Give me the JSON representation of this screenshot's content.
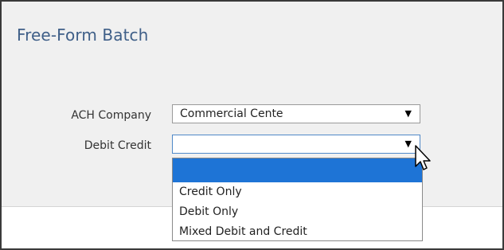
{
  "page": {
    "title": "Free-Form Batch"
  },
  "form": {
    "ach_company": {
      "label": "ACH Company",
      "value": "Commercial Cente"
    },
    "debit_credit": {
      "label": "Debit Credit",
      "value": "",
      "options": [
        "",
        "Credit Only",
        "Debit Only",
        "Mixed Debit and Credit"
      ],
      "highlighted_option": ""
    }
  },
  "icons": {
    "dropdown_arrow": "▼",
    "cursor": "mouse-pointer-icon"
  },
  "colors": {
    "title": "#3f5f88",
    "highlight": "#1e74d6",
    "panel_bg": "#f0f0f0"
  }
}
